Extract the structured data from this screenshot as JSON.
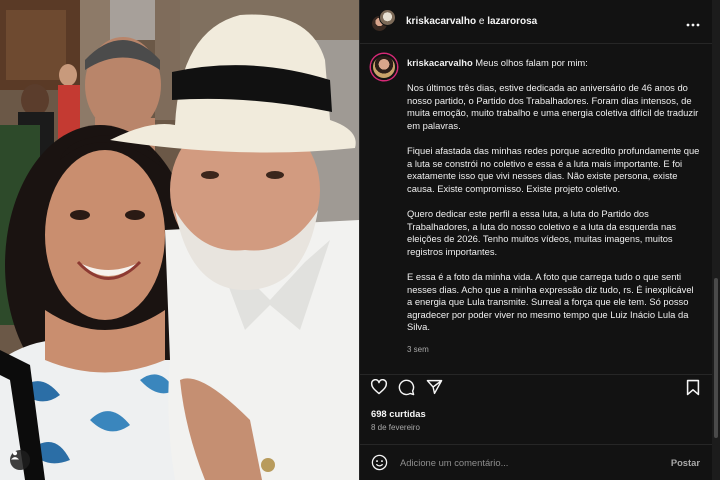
{
  "post": {
    "accounts_line": {
      "user1": "kriskacarvalho",
      "separator": " e ",
      "user2": "lazarorosa"
    },
    "caption": {
      "username": "kriskacarvalho",
      "first_line": " Meus olhos falam por mim:",
      "paragraphs": [
        "Nos últimos três dias, estive dedicada ao aniversário de 46 anos do nosso partido, o Partido dos Trabalhadores. Foram dias intensos, de muita emoção, muito trabalho e uma energia coletiva difícil de traduzir em palavras.",
        "Fiquei afastada das minhas redes porque acredito profundamente que a luta se constrói no coletivo e essa é a luta mais importante. E foi exatamente isso que vivi nesses dias. Não existe persona, existe causa. Existe compromisso. Existe projeto coletivo.",
        "Quero dedicar este perfil a essa luta, a luta do Partido dos Trabalhadores, a luta do nosso coletivo e a luta da esquerda nas eleições de 2026. Tenho muitos vídeos, muitas imagens, muitos registros importantes.",
        "E essa é a foto da minha vida. A foto que carrega tudo o que senti nesses dias. Acho que a minha expressão diz tudo, rs. É inexplicável a energia que Lula transmite. Surreal a força que ele tem. Só posso agradecer por poder viver no mesmo tempo que Luiz Inácio Lula da Silva."
      ],
      "time_ago": "3 sem"
    },
    "likes": "698 curtidas",
    "date": "8 de fevereiro",
    "comment": {
      "placeholder": "Adicione um comentário...",
      "post_label": "Postar"
    }
  },
  "icons": {
    "more": "more-options-icon",
    "like": "heart-icon",
    "comment": "comment-icon",
    "share": "share-icon",
    "save": "bookmark-icon",
    "emoji": "emoji-icon",
    "tag": "user-tag-icon"
  },
  "colors": {
    "panel_bg": "#121212",
    "text": "#f5f5f5",
    "muted": "#a8a8a8",
    "divider": "#262626"
  }
}
